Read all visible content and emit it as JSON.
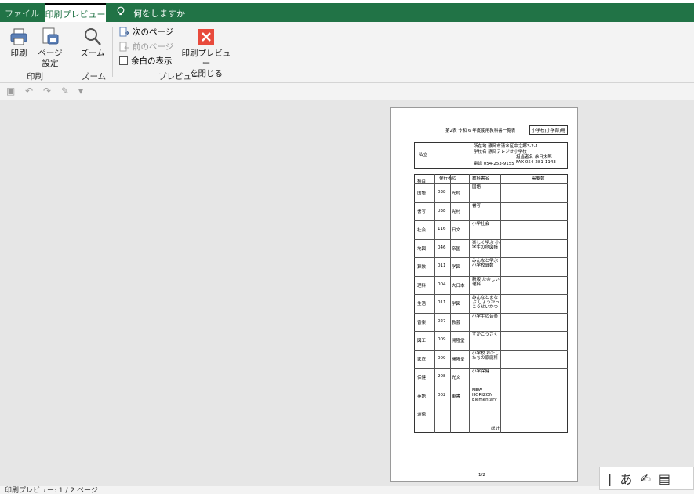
{
  "tabs": {
    "file": "ファイル",
    "print_preview": "印刷プレビュー",
    "tell_me": "何をしますか"
  },
  "ribbon": {
    "print": "印刷",
    "page_setup_line1": "ページ",
    "page_setup_line2": "設定",
    "zoom": "ズーム",
    "next_page": "次のページ",
    "prev_page": "前のページ",
    "show_margins": "余白の表示",
    "close_preview_line1": "印刷プレビュー",
    "close_preview_line2": "を閉じる",
    "group_print": "印刷",
    "group_zoom": "ズーム",
    "group_preview": "プレビュー"
  },
  "document": {
    "title": "第2表 令和 6 年度使用教科書一覧表",
    "school_type": "小学校(小学部)用",
    "category": "私立",
    "address": "所在地 静岡市清水区中之郷3-2-1",
    "school_name": "学校名 静岡テレジオ小学校",
    "responsible": "担当者名 参日太郎",
    "phone": "電話 054-253-9155",
    "fax": "FAX 054-281-1143",
    "col_subject": "種目",
    "col_publisher": "発行者の",
    "col_textbook": "教科書名",
    "col_count": "需要数",
    "total_label": "総計",
    "page_num": "1/2",
    "rows": [
      {
        "subject": "国語",
        "code": "038",
        "pub": "光村",
        "name": "国語"
      },
      {
        "subject": "書写",
        "code": "038",
        "pub": "光村",
        "name": "書写"
      },
      {
        "subject": "社会",
        "code": "116",
        "pub": "日文",
        "name": "小学社会"
      },
      {
        "subject": "地図",
        "code": "046",
        "pub": "帝国",
        "name": "楽しく学ぶ 小学生の地図帳"
      },
      {
        "subject": "算数",
        "code": "011",
        "pub": "学図",
        "name": "みんなと学ぶ 小学校算数"
      },
      {
        "subject": "理科",
        "code": "004",
        "pub": "大日本",
        "name": "新版 たのしい理科"
      },
      {
        "subject": "生活",
        "code": "011",
        "pub": "学図",
        "name": "みんなとまなぶ しょうがっこうせいかつ"
      },
      {
        "subject": "音楽",
        "code": "027",
        "pub": "教芸",
        "name": "小学生の音楽"
      },
      {
        "subject": "図工",
        "code": "009",
        "pub": "開隆堂",
        "name": "ずがこうさく"
      },
      {
        "subject": "家庭",
        "code": "009",
        "pub": "開隆堂",
        "name": "小学校 わたしたちの家庭科"
      },
      {
        "subject": "保健",
        "code": "208",
        "pub": "光文",
        "name": "小学保健"
      },
      {
        "subject": "英語",
        "code": "002",
        "pub": "東書",
        "name": "NEW HORIZON Elementary"
      },
      {
        "subject": "道徳",
        "code": "",
        "pub": "",
        "name": ""
      }
    ]
  },
  "status": {
    "text": "印刷プレビュー: 1 / 2 ページ"
  },
  "ime": {
    "mode": "あ"
  }
}
